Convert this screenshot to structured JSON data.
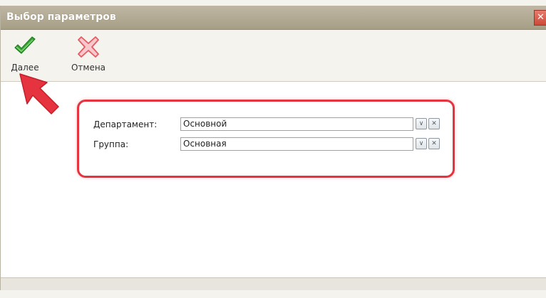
{
  "window": {
    "title": "Выбор параметров",
    "close_glyph": "✕"
  },
  "toolbar": {
    "next_label": "Далее",
    "next_icon": "check-icon",
    "cancel_label": "Отмена",
    "cancel_icon": "cross-icon"
  },
  "form": {
    "department_label": "Департамент:",
    "department_value": "Основной",
    "group_label": "Группа:",
    "group_value": "Основная",
    "dropdown_glyph": "∨",
    "clear_glyph": "✕"
  },
  "colors": {
    "highlight": "#e5333f",
    "check_green": "#3aa63a",
    "cross_red": "#e85a63"
  }
}
